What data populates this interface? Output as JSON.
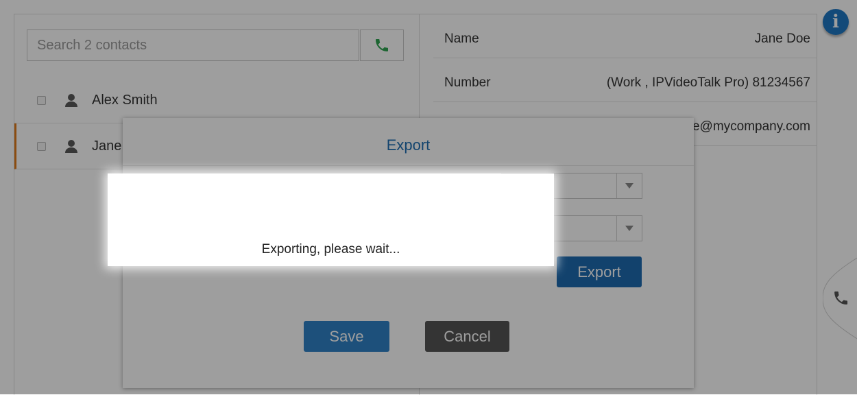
{
  "search": {
    "placeholder": "Search 2 contacts",
    "call_icon": "phone-icon"
  },
  "contacts": [
    {
      "name": "Alex Smith",
      "selected": false
    },
    {
      "name": "Jane Doe",
      "selected": true
    }
  ],
  "details": {
    "rows": [
      {
        "label": "Name",
        "value": "Jane Doe"
      },
      {
        "label": "Number",
        "value": "(Work , IPVideoTalk Pro) 81234567"
      },
      {
        "label": "",
        "value": "jane.doe@mycompany.com"
      }
    ]
  },
  "info_badge": "i",
  "dialog": {
    "title": "Export",
    "export_label": "Export",
    "save_label": "Save",
    "cancel_label": "Cancel"
  },
  "progress": {
    "message": "Exporting, please wait..."
  },
  "colors": {
    "accent": "#1e6bb0",
    "selected_marker": "#e07b1a",
    "call_green": "#2ea44f",
    "info_blue": "#1f78c4"
  }
}
